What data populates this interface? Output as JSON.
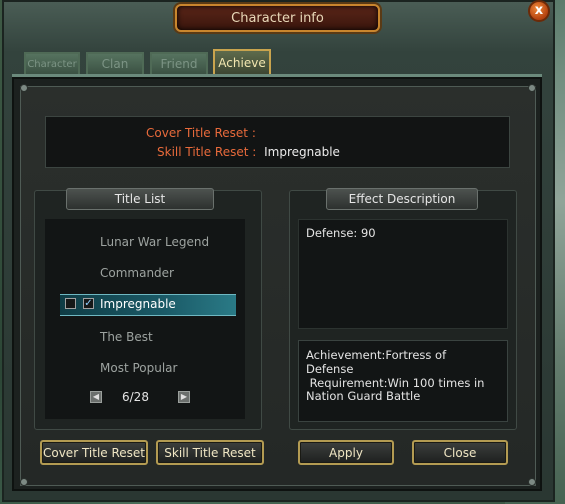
{
  "window": {
    "title": "Character info",
    "close_label": "x"
  },
  "tabs": [
    {
      "label": "Character",
      "active": false
    },
    {
      "label": "Clan",
      "active": false
    },
    {
      "label": "Friend",
      "active": false
    },
    {
      "label": "Achieve",
      "active": true
    }
  ],
  "reset_info": {
    "cover_label": "Cover Title Reset :",
    "cover_value": "",
    "skill_label": "Skill Title Reset :",
    "skill_value": "Impregnable"
  },
  "title_list": {
    "header": "Title List",
    "items": [
      "Lunar War Legend",
      "Commander",
      "Impregnable",
      "The Best",
      "Most Popular"
    ],
    "selected_index": 2,
    "page": "6/28"
  },
  "effect": {
    "header": "Effect Description",
    "text": "Defense: 90",
    "achievement_line1": "Achievement:Fortress of",
    "achievement_line2": "Defense",
    "requirement_line1": " Requirement:Win 100 times in",
    "requirement_line2": "Nation Guard Battle"
  },
  "buttons": {
    "cover_reset": "Cover Title Reset",
    "skill_reset": "Skill Title Reset",
    "apply": "Apply",
    "close": "Close"
  },
  "colors": {
    "reset_label": "#e86a3b",
    "button_border": "#b39b52",
    "selection": "#1b5b68"
  }
}
